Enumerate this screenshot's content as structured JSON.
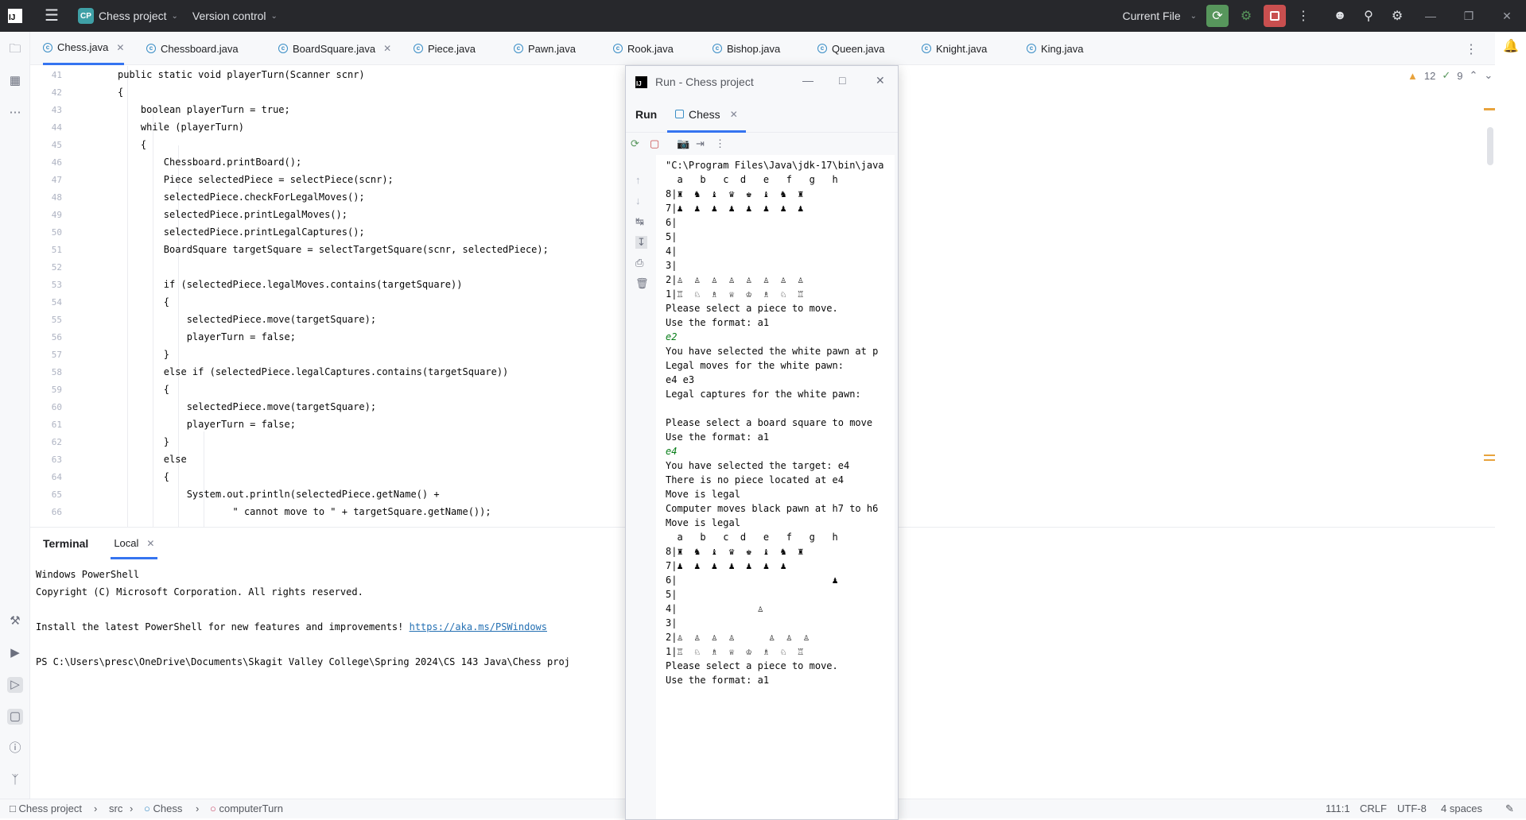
{
  "titlebar": {
    "project_badge": "CP",
    "project_name": "Chess project",
    "version_control": "Version control",
    "run_config": "Current File",
    "window_icon": "jetbrains-logo"
  },
  "tabs": [
    {
      "label": "Chess.java",
      "active": true,
      "closable": true
    },
    {
      "label": "Chessboard.java",
      "active": false,
      "closable": false
    },
    {
      "label": "BoardSquare.java",
      "active": false,
      "closable": true
    },
    {
      "label": "Piece.java",
      "active": false,
      "closable": false
    },
    {
      "label": "Pawn.java",
      "active": false,
      "closable": false
    },
    {
      "label": "Rook.java",
      "active": false,
      "closable": false
    },
    {
      "label": "Bishop.java",
      "active": false,
      "closable": false
    },
    {
      "label": "Queen.java",
      "active": false,
      "closable": false
    },
    {
      "label": "Knight.java",
      "active": false,
      "closable": false
    },
    {
      "label": "King.java",
      "active": false,
      "closable": false
    }
  ],
  "inspections": {
    "warnings": "12",
    "weak_warnings": "9"
  },
  "editor": {
    "line_numbers": [
      "41",
      "42",
      "43",
      "44",
      "45",
      "46",
      "47",
      "48",
      "49",
      "50",
      "51",
      "52",
      "53",
      "54",
      "55",
      "56",
      "57",
      "58",
      "59",
      "60",
      "61",
      "62",
      "63",
      "64",
      "65",
      "66"
    ],
    "lines": [
      "public static void playerTurn(Scanner scnr)",
      "{",
      "    boolean playerTurn = true;",
      "    while (playerTurn)",
      "    {",
      "        Chessboard.printBoard();",
      "        Piece selectedPiece = selectPiece(scnr);",
      "        selectedPiece.checkForLegalMoves();",
      "        selectedPiece.printLegalMoves();",
      "        selectedPiece.printLegalCaptures();",
      "        BoardSquare targetSquare = selectTargetSquare(scnr, selectedPiece);",
      "",
      "        if (selectedPiece.legalMoves.contains(targetSquare))",
      "        {",
      "            selectedPiece.move(targetSquare);",
      "            playerTurn = false;",
      "        }",
      "        else if (selectedPiece.legalCaptures.contains(targetSquare))",
      "        {",
      "            selectedPiece.move(targetSquare);",
      "            playerTurn = false;",
      "        }",
      "        else",
      "        {",
      "            System.out.println(selectedPiece.getName() +",
      "                    \" cannot move to \" + targetSquare.getName());"
    ]
  },
  "terminal": {
    "title": "Terminal",
    "tab": "Local",
    "lines": [
      "Windows PowerShell",
      "Copyright (C) Microsoft Corporation. All rights reserved.",
      "",
      "Install the latest PowerShell for new features and improvements! ",
      "",
      "PS C:\\Users\\presc\\OneDrive\\Documents\\Skagit Valley College\\Spring 2024\\CS 143 Java\\Chess proj"
    ],
    "link": "https://aka.ms/PSWindows"
  },
  "run_window": {
    "title": "Run - Chess project",
    "tab_run": "Run",
    "tab_chess": "Chess",
    "console": [
      {
        "t": "\"C:\\Program Files\\Java\\jdk-17\\bin\\java",
        "in": false
      },
      {
        "t": "  a   b   c  d   e   f   g   h",
        "in": false
      },
      {
        "t": "8|♜  ♞  ♝  ♛  ♚  ♝  ♞  ♜",
        "in": false
      },
      {
        "t": "7|♟  ♟  ♟  ♟  ♟  ♟  ♟  ♟",
        "in": false
      },
      {
        "t": "6|",
        "in": false
      },
      {
        "t": "5|",
        "in": false
      },
      {
        "t": "4|",
        "in": false
      },
      {
        "t": "3|",
        "in": false
      },
      {
        "t": "2|♙  ♙  ♙  ♙  ♙  ♙  ♙  ♙",
        "in": false
      },
      {
        "t": "1|♖  ♘  ♗  ♕  ♔  ♗  ♘  ♖",
        "in": false
      },
      {
        "t": "Please select a piece to move.",
        "in": false
      },
      {
        "t": "Use the format: a1",
        "in": false
      },
      {
        "t": "e2",
        "in": true
      },
      {
        "t": "You have selected the white pawn at p",
        "in": false
      },
      {
        "t": "Legal moves for the white pawn:",
        "in": false
      },
      {
        "t": "e4 e3",
        "in": false
      },
      {
        "t": "Legal captures for the white pawn:",
        "in": false
      },
      {
        "t": "",
        "in": false
      },
      {
        "t": "Please select a board square to move",
        "in": false
      },
      {
        "t": "Use the format: a1",
        "in": false
      },
      {
        "t": "e4",
        "in": true
      },
      {
        "t": "You have selected the target: e4",
        "in": false
      },
      {
        "t": "There is no piece located at e4",
        "in": false
      },
      {
        "t": "Move is legal",
        "in": false
      },
      {
        "t": "Computer moves black pawn at h7 to h6",
        "in": false
      },
      {
        "t": "Move is legal",
        "in": false
      },
      {
        "t": "  a   b   c  d   e   f   g   h",
        "in": false
      },
      {
        "t": "8|♜  ♞  ♝  ♛  ♚  ♝  ♞  ♜",
        "in": false
      },
      {
        "t": "7|♟  ♟  ♟  ♟  ♟  ♟  ♟",
        "in": false
      },
      {
        "t": "6|                           ♟",
        "in": false
      },
      {
        "t": "5|",
        "in": false
      },
      {
        "t": "4|              ♙",
        "in": false
      },
      {
        "t": "3|",
        "in": false
      },
      {
        "t": "2|♙  ♙  ♙  ♙      ♙  ♙  ♙",
        "in": false
      },
      {
        "t": "1|♖  ♘  ♗  ♕  ♔  ♗  ♘  ♖",
        "in": false
      },
      {
        "t": "Please select a piece to move.",
        "in": false
      },
      {
        "t": "Use the format: a1",
        "in": false
      }
    ]
  },
  "statusbar": {
    "breadcrumb": [
      "Chess project",
      "src",
      "Chess",
      "computerTurn"
    ],
    "position": "111:1",
    "line_sep": "CRLF",
    "encoding": "UTF-8",
    "indent": "4 spaces"
  }
}
